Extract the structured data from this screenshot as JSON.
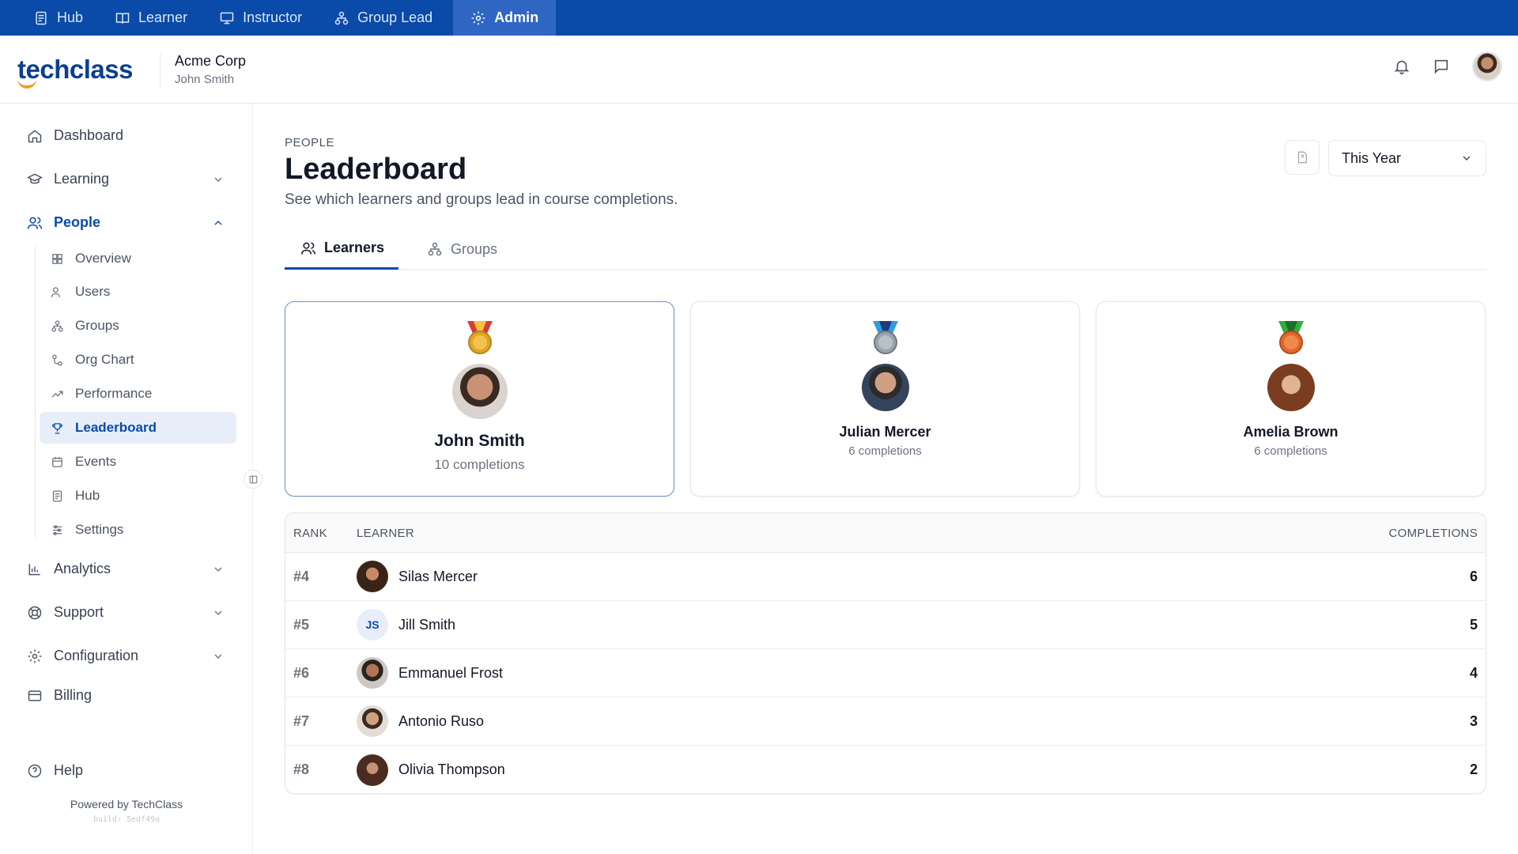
{
  "topnav": {
    "tabs": [
      {
        "label": "Hub",
        "icon": "hub-icon"
      },
      {
        "label": "Learner",
        "icon": "book-icon"
      },
      {
        "label": "Instructor",
        "icon": "presentation-icon"
      },
      {
        "label": "Group Lead",
        "icon": "hierarchy-icon"
      },
      {
        "label": "Admin",
        "icon": "gear-icon",
        "active": true
      }
    ],
    "bg_color": "#0a4aa8",
    "active_color": "#2f66c4"
  },
  "header": {
    "logo_text": "techclass",
    "org_name": "Acme Corp",
    "user_name": "John Smith"
  },
  "sidebar": {
    "items": [
      {
        "label": "Dashboard",
        "icon": "home-icon"
      },
      {
        "label": "Learning",
        "icon": "graduation-cap-icon",
        "chevron": "down"
      },
      {
        "label": "People",
        "icon": "users-icon",
        "chevron": "up",
        "active": true
      },
      {
        "label": "Analytics",
        "icon": "bar-chart-icon",
        "chevron": "down"
      },
      {
        "label": "Support",
        "icon": "lifebuoy-icon",
        "chevron": "down"
      },
      {
        "label": "Configuration",
        "icon": "gear-icon",
        "chevron": "down"
      },
      {
        "label": "Billing",
        "icon": "credit-card-icon"
      },
      {
        "label": "Help",
        "icon": "help-circle-icon"
      }
    ],
    "people_sub": [
      {
        "label": "Overview",
        "icon": "grid-icon"
      },
      {
        "label": "Users",
        "icon": "users-icon"
      },
      {
        "label": "Groups",
        "icon": "hierarchy-icon"
      },
      {
        "label": "Org Chart",
        "icon": "org-chart-icon"
      },
      {
        "label": "Performance",
        "icon": "trending-up-icon"
      },
      {
        "label": "Leaderboard",
        "icon": "trophy-icon",
        "active": true
      },
      {
        "label": "Events",
        "icon": "calendar-icon"
      },
      {
        "label": "Hub",
        "icon": "hub-icon"
      },
      {
        "label": "Settings",
        "icon": "sliders-icon"
      }
    ],
    "powered_by": "Powered by TechClass",
    "build": "build: 5edf49a"
  },
  "page": {
    "eyebrow": "PEOPLE",
    "title": "Leaderboard",
    "subtitle": "See which learners and groups lead in course completions.",
    "period": "This Year",
    "tabs": [
      {
        "label": "Learners",
        "active": true
      },
      {
        "label": "Groups"
      }
    ]
  },
  "podium": [
    {
      "rank": 1,
      "name": "John Smith",
      "completions": "10 completions",
      "medal_color": "#e0a526",
      "ribbon_color": "#d93a3a"
    },
    {
      "rank": 2,
      "name": "Julian Mercer",
      "completions": "6 completions",
      "medal_color": "#9aa3ad",
      "ribbon_color": "#2f9be0"
    },
    {
      "rank": 3,
      "name": "Amelia Brown",
      "completions": "6 completions",
      "medal_color": "#e2672b",
      "ribbon_color": "#2fae3f"
    }
  ],
  "table": {
    "headers": {
      "rank": "RANK",
      "learner": "LEARNER",
      "completions": "COMPLETIONS"
    },
    "rows": [
      {
        "rank": "#4",
        "name": "Silas Mercer",
        "completions": "6"
      },
      {
        "rank": "#5",
        "name": "Jill Smith",
        "initials": "JS",
        "completions": "5"
      },
      {
        "rank": "#6",
        "name": "Emmanuel Frost",
        "completions": "4"
      },
      {
        "rank": "#7",
        "name": "Antonio Ruso",
        "completions": "3"
      },
      {
        "rank": "#8",
        "name": "Olivia Thompson",
        "completions": "2"
      }
    ]
  }
}
